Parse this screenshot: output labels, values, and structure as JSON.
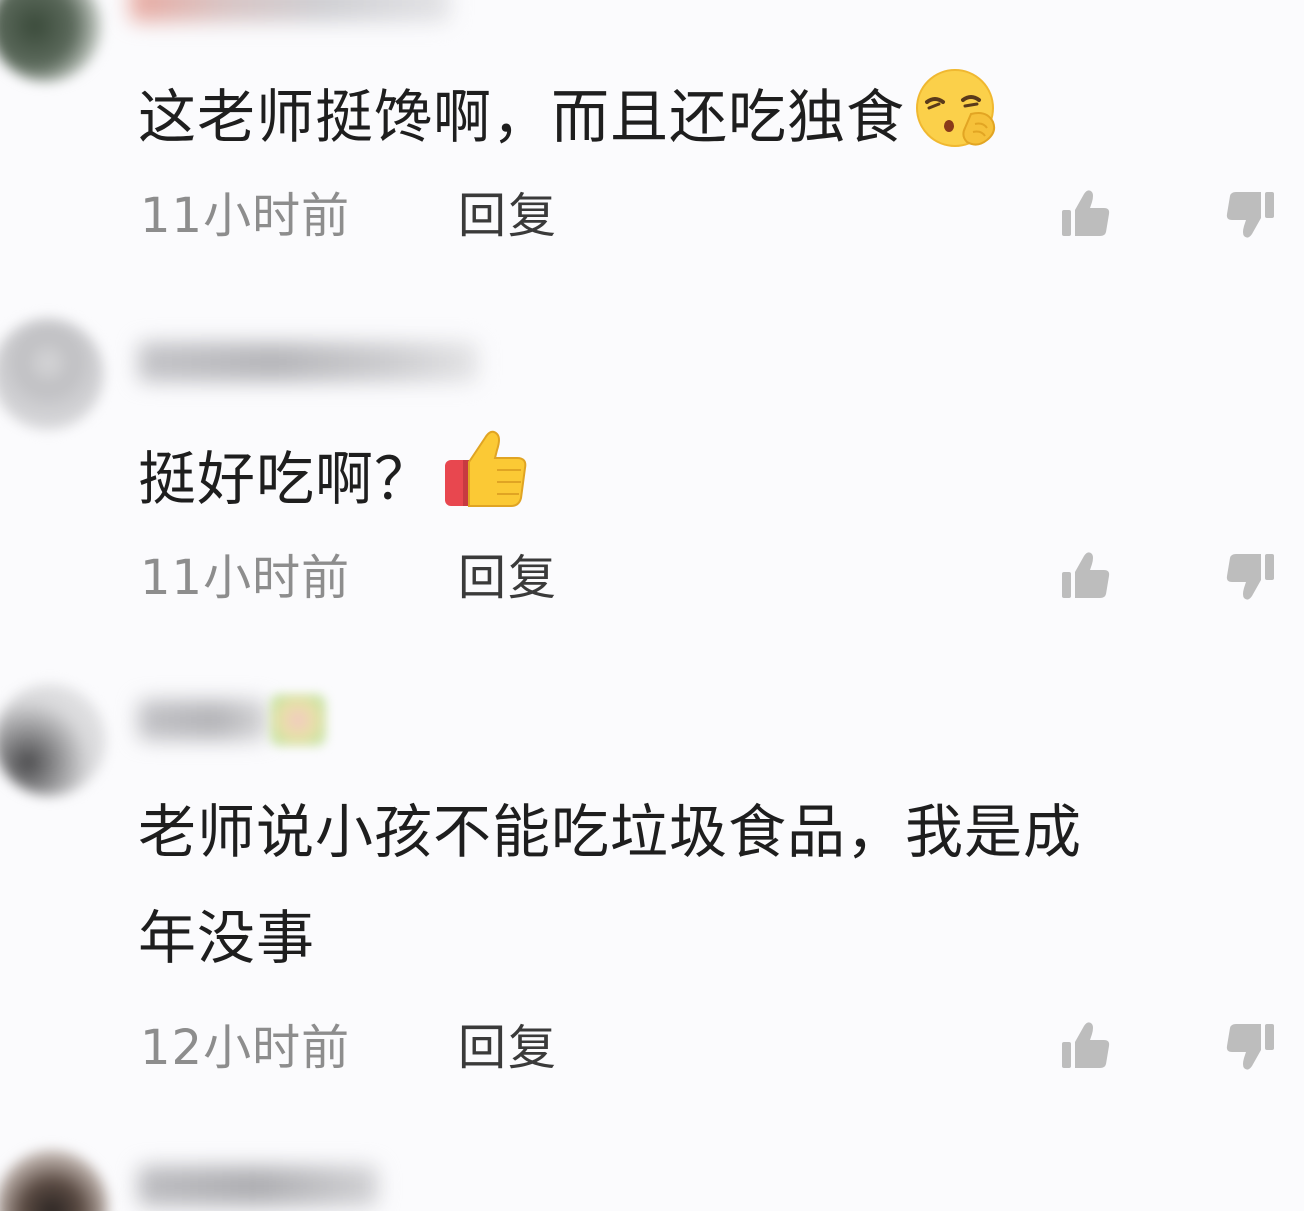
{
  "comments": [
    {
      "text": "这老师挺馋啊，而且还吃独食",
      "emoji": "shushing-face-emoji",
      "time": "11小时前",
      "reply_label": "回复"
    },
    {
      "text": "挺好吃啊？",
      "emoji": "thumbs-up-emoji",
      "time": "11小时前",
      "reply_label": "回复"
    },
    {
      "text_line1": "老师说小孩不能吃垃圾食品，我是成",
      "text_line2": "年没事",
      "time": "12小时前",
      "reply_label": "回复"
    }
  ],
  "icons": {
    "like": "thumbs-up-icon",
    "dislike": "thumbs-down-icon"
  },
  "colors": {
    "background": "#fbfbfd",
    "text": "#1e1e1e",
    "time": "#8d8d8d",
    "reply": "#3a3a3a",
    "icon": "#bdbdbd"
  }
}
